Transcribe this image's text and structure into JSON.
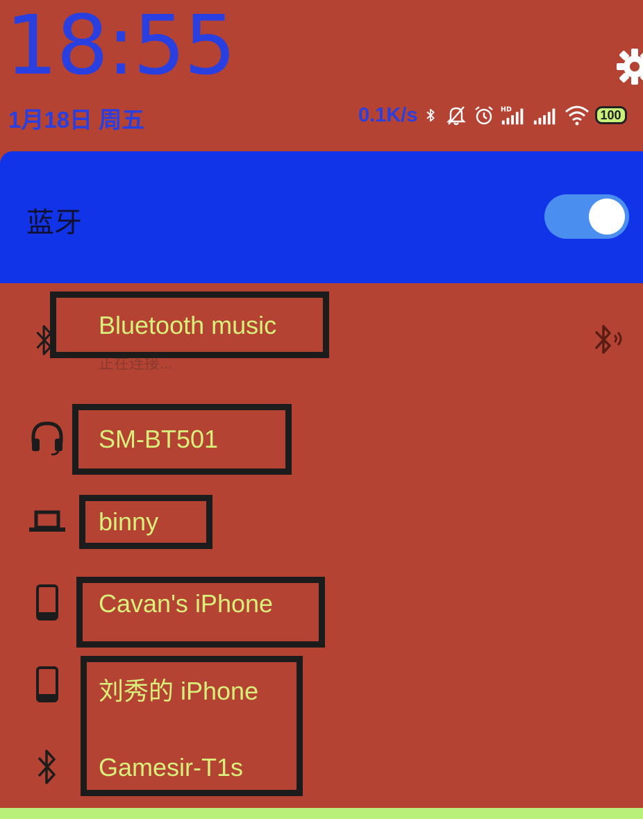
{
  "status_bar": {
    "time": "18:55",
    "date": "1月18日 周五",
    "network_speed": "0.1K/s",
    "battery": "100",
    "icons": [
      "bluetooth-icon",
      "bell-muted-icon",
      "alarm-icon",
      "hd-signal-icon",
      "signal-icon",
      "wifi-icon",
      "battery-icon"
    ]
  },
  "quick_settings": {
    "gear_icon": "gear-icon"
  },
  "bluetooth": {
    "title": "蓝牙",
    "enabled": true,
    "colors": {
      "card": "#1234e8",
      "toggle": "#4a8ff0",
      "device_text": "#d8ef7a"
    }
  },
  "devices": [
    {
      "name": "Bluetooth music",
      "status": "正在连接...",
      "icon": "bluetooth-icon",
      "action_icon": "bluetooth-audio-icon"
    },
    {
      "name": "SM-BT501",
      "icon": "headset-icon"
    },
    {
      "name": "binny",
      "icon": "laptop-icon"
    },
    {
      "name": "Cavan's iPhone",
      "icon": "phone-icon"
    },
    {
      "name": "刘秀的 iPhone",
      "icon": "phone-icon"
    },
    {
      "name": "Gamesir-T1s",
      "icon": "bluetooth-icon"
    }
  ]
}
